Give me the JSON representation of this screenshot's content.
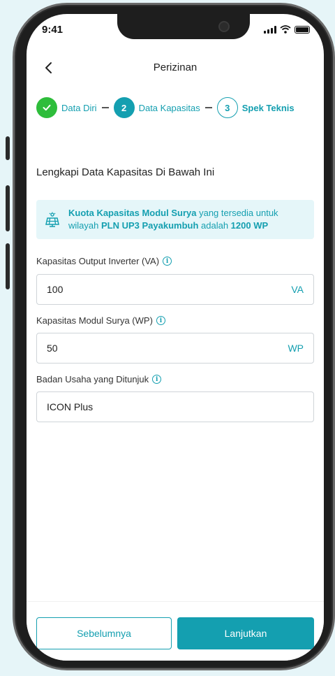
{
  "status": {
    "time": "9:41"
  },
  "header": {
    "title": "Perizinan"
  },
  "stepper": {
    "steps": [
      {
        "label": "Data Diri",
        "state": "done"
      },
      {
        "number": "2",
        "label": "Data Kapasitas",
        "state": "active"
      },
      {
        "number": "3",
        "label": "Spek Teknis",
        "state": "todo"
      }
    ]
  },
  "section": {
    "title": "Lengkapi Data Kapasitas Di Bawah Ini"
  },
  "info": {
    "part1": "Kuota Kapasitas Modul Surya",
    "part2": " yang tersedia untuk wilayah ",
    "part3": "PLN UP3 Payakumbuh",
    "part4": " adalah ",
    "part5": "1200 WP"
  },
  "form": {
    "inverter": {
      "label": "Kapasitas Output Inverter (VA)",
      "value": "100",
      "unit": "VA"
    },
    "module": {
      "label": "Kapasitas Modul Surya (WP)",
      "value": "50",
      "unit": "WP"
    },
    "company": {
      "label": "Badan Usaha yang Ditunjuk",
      "value": "ICON Plus"
    }
  },
  "help_glyph": "i",
  "buttons": {
    "prev": "Sebelumnya",
    "next": "Lanjutkan"
  },
  "colors": {
    "accent": "#149fb0",
    "success": "#2ebd3b",
    "info_bg": "#e5f6f9"
  }
}
